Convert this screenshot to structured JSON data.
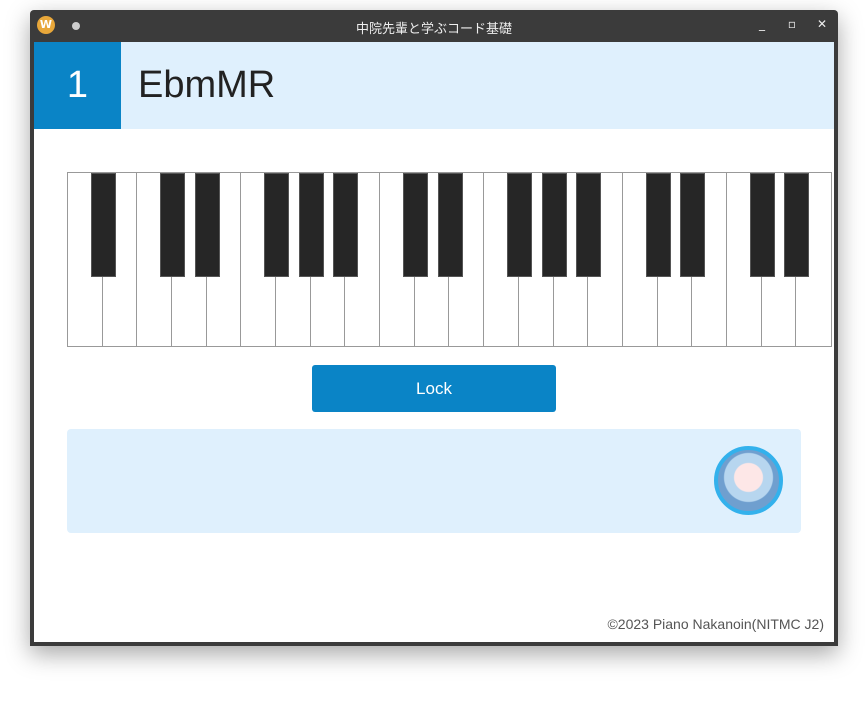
{
  "window": {
    "title": "中院先輩と学ぶコード基礎",
    "app_icon_letter": "W"
  },
  "header": {
    "number": "1",
    "chord": "EbmMR"
  },
  "piano": {
    "white_keys": [
      "A",
      "B",
      "C",
      "D",
      "E",
      "F",
      "G",
      "A",
      "B",
      "C",
      "D",
      "E",
      "F",
      "G",
      "A",
      "B",
      "C",
      "D",
      "E",
      "F",
      "G",
      "A"
    ],
    "pressed": []
  },
  "lock_label": "Lock",
  "message": {
    "text": ""
  },
  "footer": "©2023 Piano Nakanoin(NITMC J2)",
  "colors": {
    "accent": "#0a84c6",
    "light": "#dff0fd"
  }
}
